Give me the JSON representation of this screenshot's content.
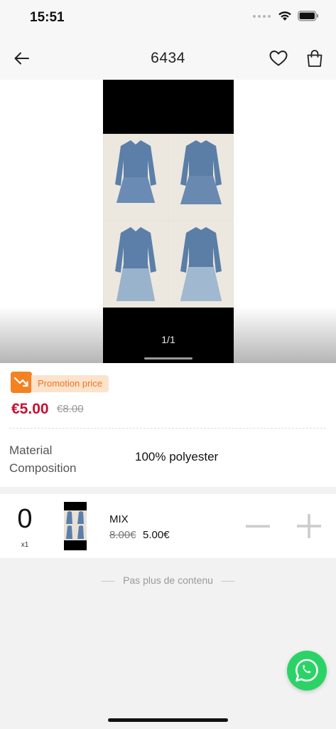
{
  "status_bar": {
    "time": "15:51",
    "icons": [
      "signal-dots-icon",
      "wifi-icon",
      "battery-icon"
    ]
  },
  "header": {
    "title": "6434",
    "icons": [
      "back-arrow-icon",
      "heart-icon",
      "shopping-bag-icon"
    ]
  },
  "gallery": {
    "counter": "1/1"
  },
  "product": {
    "promo_label": "Promotion price",
    "price": "€5.00",
    "original_price": "€8.00",
    "attributes": [
      {
        "label": "Material Composition",
        "value": "100% polyester"
      }
    ]
  },
  "variant": {
    "quantity": "0",
    "unit": "x1",
    "name": "MIX",
    "old_price": "8.00€",
    "new_price": "5.00€"
  },
  "footer": {
    "end_text": "Pas plus de contenu"
  },
  "colors": {
    "price_red": "#c8102e",
    "promo_orange": "#f58220",
    "whatsapp_green": "#2bd366"
  }
}
